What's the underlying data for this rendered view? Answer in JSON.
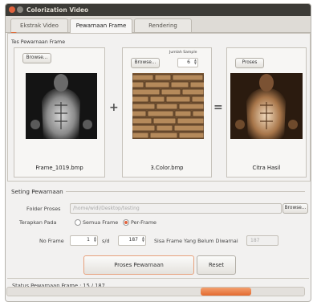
{
  "window": {
    "title": "Colorization Video"
  },
  "tabs": [
    {
      "label": "Ekstrak Video"
    },
    {
      "label": "Pewarnaan Frame"
    },
    {
      "label": "Rendering"
    }
  ],
  "test_panel": {
    "title": "Tes Pewarnaan Frame",
    "source": {
      "browse_label": "Browse...",
      "caption": "Frame_1019.bmp"
    },
    "color": {
      "browse_label": "Browse...",
      "sample_label": "Jumlah Sample",
      "sample_value": "6",
      "caption": "3.Color.bmp"
    },
    "result": {
      "process_label": "Proses",
      "caption": "Citra Hasil"
    },
    "plus": "+",
    "equals": "="
  },
  "settings": {
    "title": "Seting Pewarnaan",
    "folder_label": "Folder Proses",
    "folder_value": "/home/widi/Desktop/testing",
    "folder_browse": "Browse...",
    "apply_label": "Terapkan Pada",
    "radio_all": "Semua Frame",
    "radio_per": "Per-Frame",
    "no_frame_label": "No Frame",
    "frame_from": "1",
    "sd": "s/d",
    "frame_to": "187",
    "remaining_label": "Sisa Frame Yang Belum Diwarnai",
    "remaining_value": "187",
    "process_button": "Proses Pewarnaan",
    "reset_button": "Reset"
  },
  "status": {
    "text": "Status Pewarnaan Frame : 15 / 187",
    "progress": 0.39
  },
  "colors": {
    "accent": "#e36a2f",
    "titlebar": "#3c3b37",
    "sepia": "#8a5a32"
  }
}
